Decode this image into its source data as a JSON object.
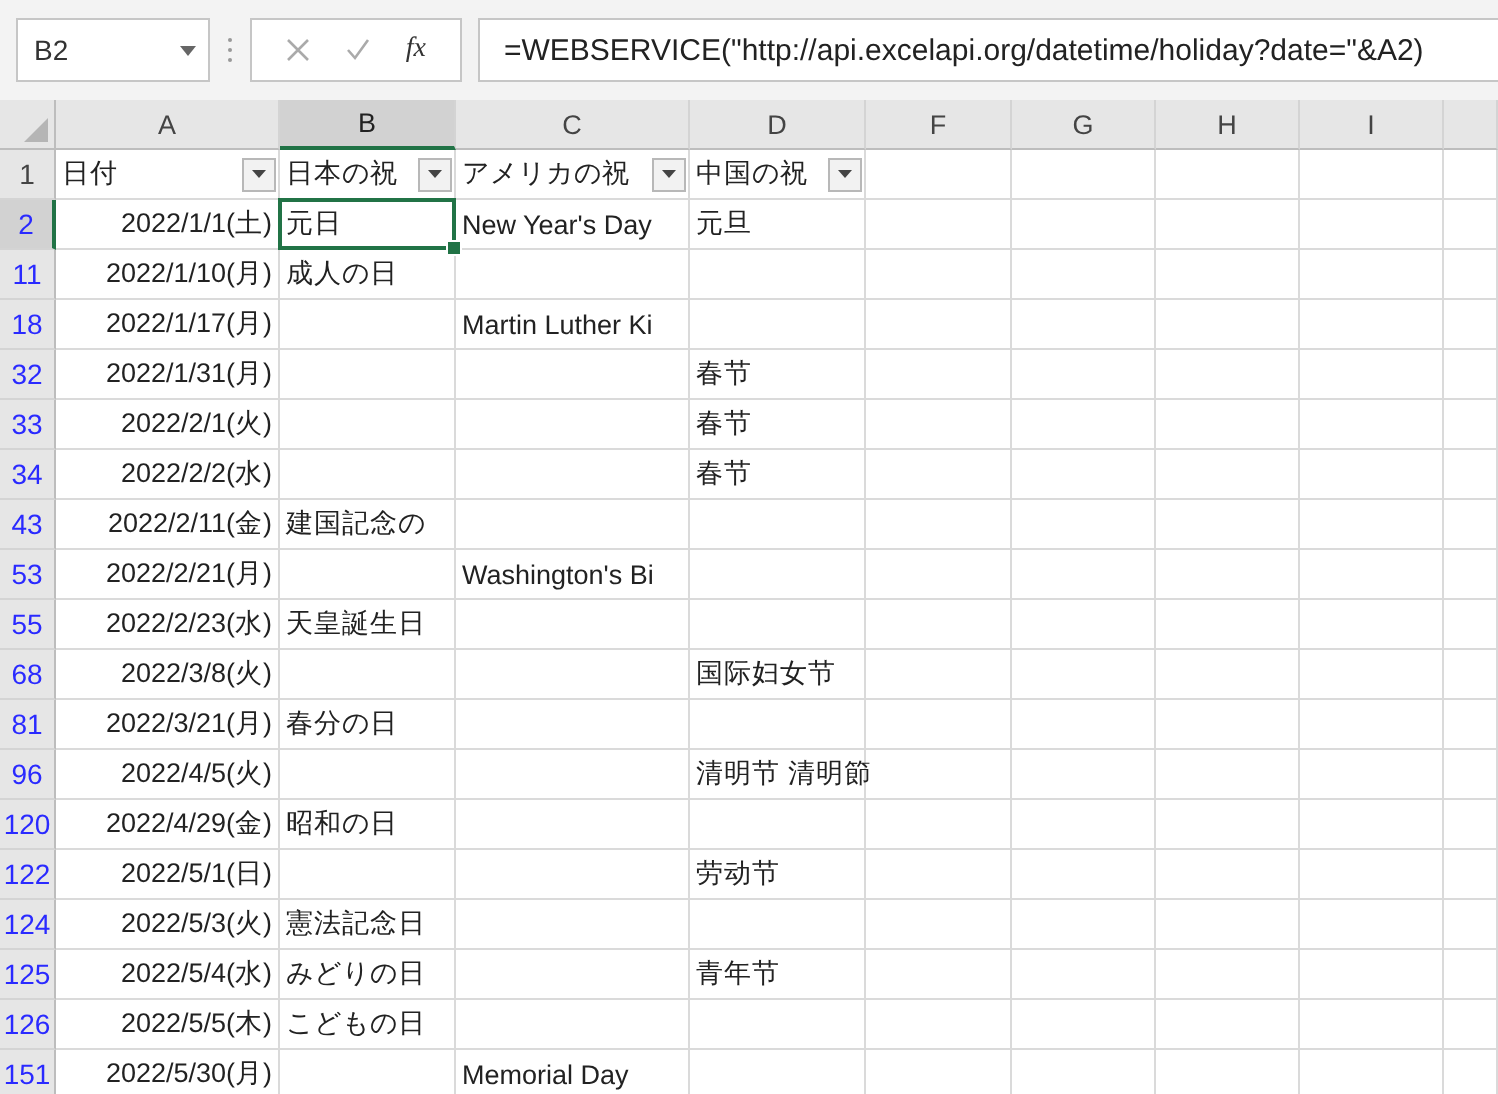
{
  "formula_bar": {
    "name_box": "B2",
    "fx": "fx",
    "formula": "=WEBSERVICE(\"http://api.excelapi.org/datetime/holiday?date=\"&A2)"
  },
  "columns": [
    {
      "label": "A",
      "selected": false
    },
    {
      "label": "B",
      "selected": true
    },
    {
      "label": "C",
      "selected": false
    },
    {
      "label": "D",
      "selected": false
    },
    {
      "label": "F",
      "selected": false
    },
    {
      "label": "G",
      "selected": false
    },
    {
      "label": "H",
      "selected": false
    },
    {
      "label": "I",
      "selected": false
    }
  ],
  "header_row": {
    "number": "1",
    "cells": [
      {
        "text": "日付",
        "filter": true
      },
      {
        "text": "日本の祝",
        "filter": true
      },
      {
        "text": "アメリカの祝",
        "filter": true
      },
      {
        "text": "中国の祝",
        "filter": true
      }
    ]
  },
  "rows": [
    {
      "number": "2",
      "filtered": true,
      "selected": true,
      "cells": [
        "2022/1/1(土)",
        "元日",
        "New Year's Day",
        "元旦"
      ]
    },
    {
      "number": "11",
      "filtered": true,
      "selected": false,
      "cells": [
        "2022/1/10(月)",
        "成人の日",
        null,
        null
      ]
    },
    {
      "number": "18",
      "filtered": true,
      "selected": false,
      "cells": [
        "2022/1/17(月)",
        null,
        "Martin Luther Ki",
        null
      ]
    },
    {
      "number": "32",
      "filtered": true,
      "selected": false,
      "cells": [
        "2022/1/31(月)",
        null,
        null,
        "春节"
      ]
    },
    {
      "number": "33",
      "filtered": true,
      "selected": false,
      "cells": [
        "2022/2/1(火)",
        null,
        null,
        "春节"
      ]
    },
    {
      "number": "34",
      "filtered": true,
      "selected": false,
      "cells": [
        "2022/2/2(水)",
        null,
        null,
        "春节"
      ]
    },
    {
      "number": "43",
      "filtered": true,
      "selected": false,
      "cells": [
        "2022/2/11(金)",
        "建国記念の",
        null,
        null
      ]
    },
    {
      "number": "53",
      "filtered": true,
      "selected": false,
      "cells": [
        "2022/2/21(月)",
        null,
        "Washington's Bi",
        null
      ]
    },
    {
      "number": "55",
      "filtered": true,
      "selected": false,
      "cells": [
        "2022/2/23(水)",
        "天皇誕生日",
        null,
        null
      ]
    },
    {
      "number": "68",
      "filtered": true,
      "selected": false,
      "cells": [
        "2022/3/8(火)",
        null,
        null,
        "国际妇女节"
      ]
    },
    {
      "number": "81",
      "filtered": true,
      "selected": false,
      "cells": [
        "2022/3/21(月)",
        "春分の日",
        null,
        null
      ]
    },
    {
      "number": "96",
      "filtered": true,
      "selected": false,
      "cells": [
        "2022/4/5(火)",
        null,
        null,
        "清明节 清明節"
      ]
    },
    {
      "number": "120",
      "filtered": true,
      "selected": false,
      "cells": [
        "2022/4/29(金)",
        "昭和の日",
        null,
        null
      ]
    },
    {
      "number": "122",
      "filtered": true,
      "selected": false,
      "cells": [
        "2022/5/1(日)",
        null,
        null,
        "劳动节"
      ]
    },
    {
      "number": "124",
      "filtered": true,
      "selected": false,
      "cells": [
        "2022/5/3(火)",
        "憲法記念日",
        null,
        null
      ]
    },
    {
      "number": "125",
      "filtered": true,
      "selected": false,
      "cells": [
        "2022/5/4(水)",
        "みどりの日",
        null,
        "青年节"
      ]
    },
    {
      "number": "126",
      "filtered": true,
      "selected": false,
      "cells": [
        "2022/5/5(木)",
        "こどもの日",
        null,
        null
      ]
    },
    {
      "number": "151",
      "filtered": true,
      "selected": false,
      "cells": [
        "2022/5/30(月)",
        null,
        "Memorial Day",
        null
      ]
    }
  ]
}
